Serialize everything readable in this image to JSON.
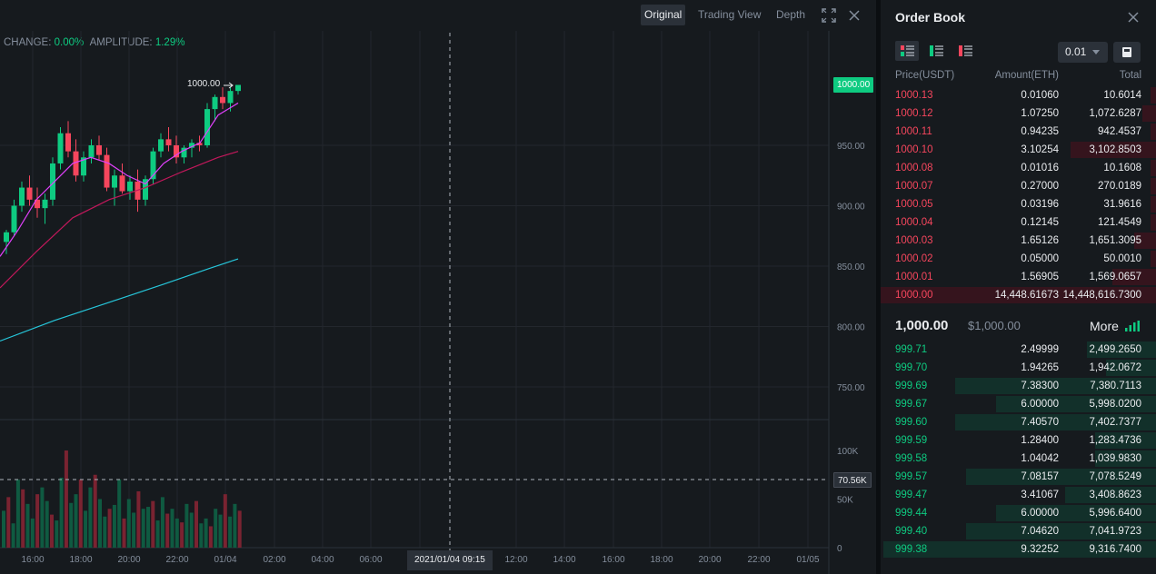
{
  "chart": {
    "tabs": [
      "Original",
      "Trading View",
      "Depth"
    ],
    "active_tab": 0,
    "stats": {
      "change_label": "CHANGE:",
      "change_value": "0.00%",
      "amplitude_label": "AMPLITUDE:",
      "amplitude_value": "1.29%"
    },
    "last_candle_label": "1000.00",
    "last_price_tag": "1000.00",
    "volume_tag": "70.56K",
    "crosshair_time": "2021/01/04 09:15",
    "price_axis": [
      {
        "label": "950.00",
        "value": 950
      },
      {
        "label": "900.00",
        "value": 900
      },
      {
        "label": "850.00",
        "value": 850
      },
      {
        "label": "800.00",
        "value": 800
      },
      {
        "label": "750.00",
        "value": 750
      }
    ],
    "volume_axis": [
      {
        "label": "100K",
        "value": 100000
      },
      {
        "label": "50K",
        "value": 50000
      },
      {
        "label": "0",
        "value": 0
      }
    ],
    "time_axis": [
      "16:00",
      "18:00",
      "20:00",
      "22:00",
      "01/04",
      "02:00",
      "04:00",
      "06:00",
      "",
      "12:00",
      "14:00",
      "16:00",
      "18:00",
      "20:00",
      "22:00",
      "01/05"
    ],
    "colors": {
      "up": "#0ecb81",
      "down": "#f6465d",
      "ma7": "#e040fb",
      "ma25": "#c2185b",
      "ma99": "#26c6da",
      "grid": "#23272d"
    }
  },
  "orderbook": {
    "title": "Order Book",
    "precision": "0.01",
    "headers": {
      "price": "Price(USDT)",
      "amount": "Amount(ETH)",
      "total": "Total"
    },
    "asks": [
      {
        "price": "1000.13",
        "amount": "0.01060",
        "total": "10.6014",
        "depth": 0.02
      },
      {
        "price": "1000.12",
        "amount": "1.07250",
        "total": "1,072.6287",
        "depth": 0.05
      },
      {
        "price": "1000.11",
        "amount": "0.94235",
        "total": "942.4537",
        "depth": 0.02
      },
      {
        "price": "1000.10",
        "amount": "3.10254",
        "total": "3,102.8503",
        "depth": 0.31
      },
      {
        "price": "1000.08",
        "amount": "0.01016",
        "total": "10.1608",
        "depth": 0.02
      },
      {
        "price": "1000.07",
        "amount": "0.27000",
        "total": "270.0189",
        "depth": 0.02
      },
      {
        "price": "1000.05",
        "amount": "0.03196",
        "total": "31.9616",
        "depth": 0.02
      },
      {
        "price": "1000.04",
        "amount": "0.12145",
        "total": "121.4549",
        "depth": 0.02
      },
      {
        "price": "1000.03",
        "amount": "1.65126",
        "total": "1,651.3095",
        "depth": 0.08
      },
      {
        "price": "1000.02",
        "amount": "0.05000",
        "total": "50.0010",
        "depth": 0.02
      },
      {
        "price": "1000.01",
        "amount": "1.56905",
        "total": "1,569.0657",
        "depth": 0.16
      },
      {
        "price": "1000.00",
        "amount": "14,448.61673",
        "total": "14,448,616.7300",
        "depth": 1.0
      }
    ],
    "mid": {
      "price": "1,000.00",
      "usd": "$1,000.00",
      "more": "More"
    },
    "bids": [
      {
        "price": "999.71",
        "amount": "2.49999",
        "total": "2,499.2650",
        "depth": 0.25
      },
      {
        "price": "999.70",
        "amount": "1.94265",
        "total": "1,942.0672",
        "depth": 0.18
      },
      {
        "price": "999.69",
        "amount": "7.38300",
        "total": "7,380.7113",
        "depth": 0.73
      },
      {
        "price": "999.67",
        "amount": "6.00000",
        "total": "5,998.0200",
        "depth": 0.58
      },
      {
        "price": "999.60",
        "amount": "7.40570",
        "total": "7,402.7377",
        "depth": 0.73
      },
      {
        "price": "999.59",
        "amount": "1.28400",
        "total": "1,283.4736",
        "depth": 0.22
      },
      {
        "price": "999.58",
        "amount": "1.04042",
        "total": "1,039.9830",
        "depth": 0.22
      },
      {
        "price": "999.57",
        "amount": "7.08157",
        "total": "7,078.5249",
        "depth": 0.69
      },
      {
        "price": "999.47",
        "amount": "3.41067",
        "total": "3,408.8623",
        "depth": 0.33
      },
      {
        "price": "999.44",
        "amount": "6.00000",
        "total": "5,996.6400",
        "depth": 0.58
      },
      {
        "price": "999.40",
        "amount": "7.04620",
        "total": "7,041.9723",
        "depth": 0.69
      },
      {
        "price": "999.38",
        "amount": "9.32252",
        "total": "9,316.7400",
        "depth": 0.99
      }
    ]
  }
}
